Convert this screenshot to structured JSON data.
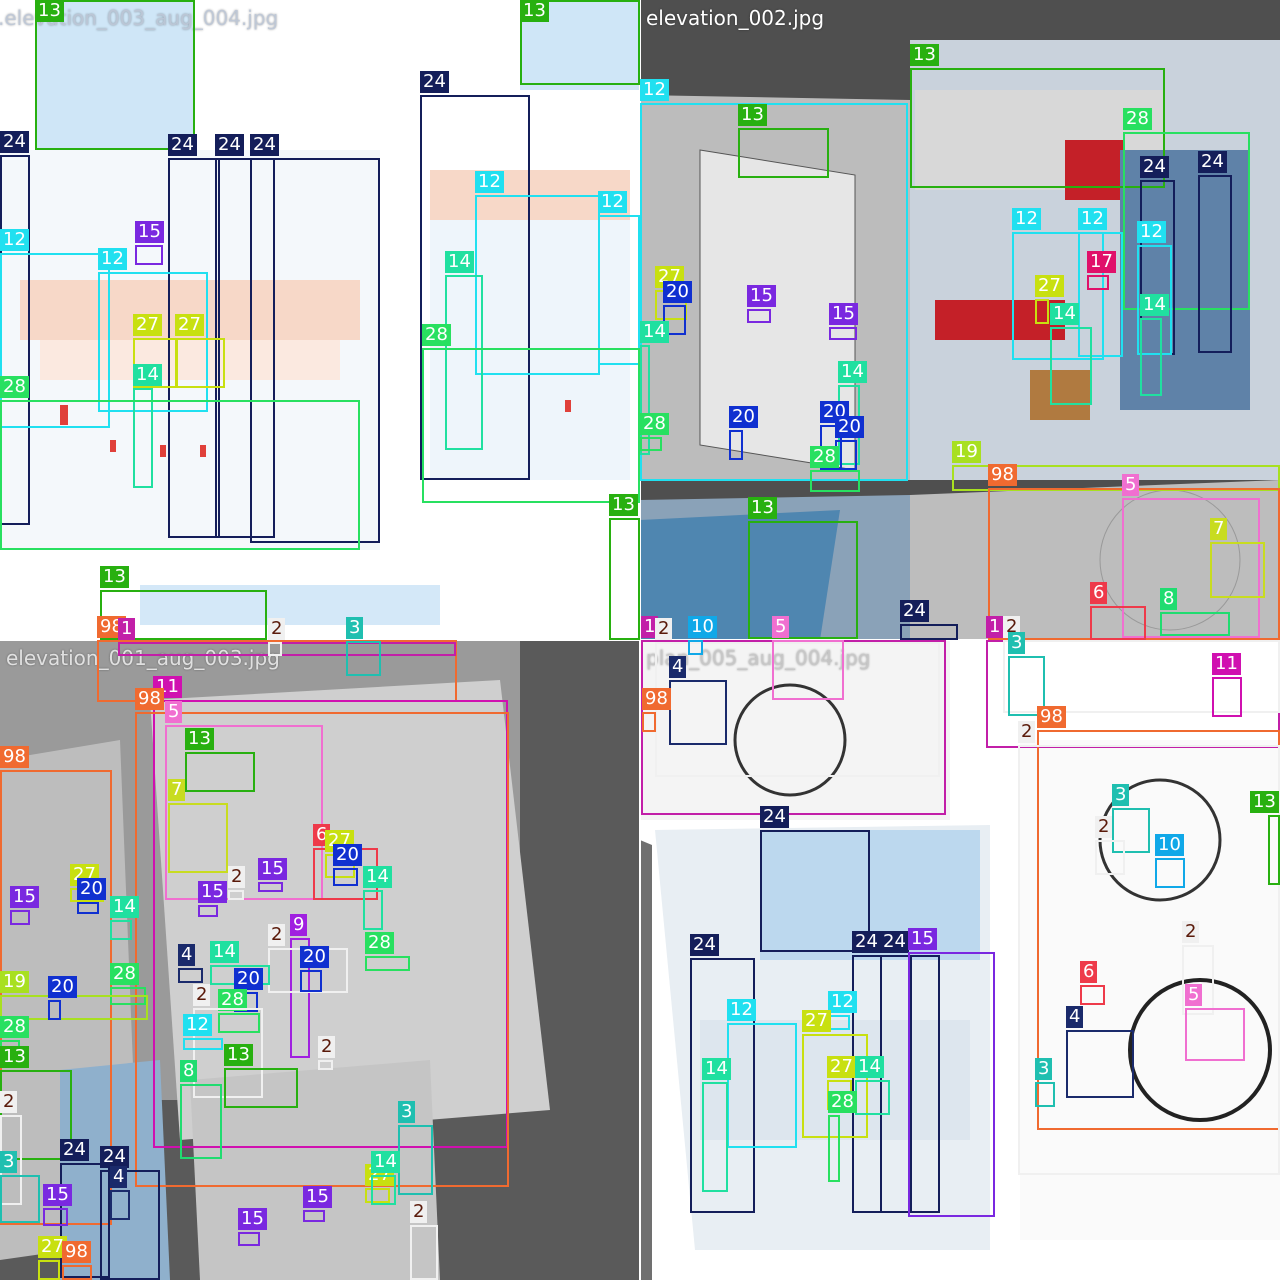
{
  "mosaic": {
    "tiles": [
      {
        "id": "tl",
        "filename": ".elevation_003_aug_004.jpg"
      },
      {
        "id": "tr",
        "filename": "elevation_002.jpg"
      },
      {
        "id": "bl",
        "filename": "elevation_001_aug_003.jpg"
      },
      {
        "id": "br",
        "filename": "plan_005_aug_004.jpg"
      }
    ]
  },
  "class_colors": {
    "1": "#c21fa8",
    "2": "#f0f0f0",
    "3": "#1fbfb0",
    "4": "#1a2a6b",
    "5": "#f06fd0",
    "6": "#ee3a4a",
    "7": "#c8dc20",
    "8": "#20dc70",
    "9": "#a020e0",
    "10": "#10a8e8",
    "11": "#d010b0",
    "12": "#20e0f0",
    "13": "#28b010",
    "14": "#20e0a0",
    "15": "#7a28e0",
    "17": "#e0106a",
    "19": "#a8e020",
    "20": "#1030d0",
    "24": "#141e5a",
    "27": "#c8e010",
    "28": "#28e060",
    "98": "#f06a30"
  },
  "detections": [
    {
      "c": "13",
      "l": "13"
    },
    {
      "c": "13",
      "l": "13"
    },
    {
      "c": "24",
      "l": "24"
    },
    {
      "c": "24",
      "l": "24"
    },
    {
      "c": "24",
      "l": "24"
    },
    {
      "c": "24",
      "l": "24"
    },
    {
      "c": "24",
      "l": "24"
    },
    {
      "c": "12",
      "l": "12"
    },
    {
      "c": "12",
      "l": "12"
    },
    {
      "c": "12",
      "l": "12"
    },
    {
      "c": "12",
      "l": "12"
    },
    {
      "c": "15",
      "l": "15"
    },
    {
      "c": "27",
      "l": "27"
    },
    {
      "c": "27",
      "l": "27"
    },
    {
      "c": "14",
      "l": "14"
    },
    {
      "c": "14",
      "l": "14"
    },
    {
      "c": "28",
      "l": "28"
    },
    {
      "c": "28",
      "l": "28"
    },
    {
      "c": "13",
      "l": "13"
    },
    {
      "c": "13",
      "l": "13"
    },
    {
      "c": "13",
      "l": "13"
    },
    {
      "c": "12",
      "l": "12"
    },
    {
      "c": "13",
      "l": "13"
    },
    {
      "c": "28",
      "l": "28"
    },
    {
      "c": "24",
      "l": "24"
    },
    {
      "c": "24",
      "l": "24"
    },
    {
      "c": "12",
      "l": "12"
    },
    {
      "c": "12",
      "l": "12"
    },
    {
      "c": "17",
      "l": "17"
    },
    {
      "c": "12",
      "l": "12"
    },
    {
      "c": "27",
      "l": "27"
    },
    {
      "c": "14",
      "l": "14"
    },
    {
      "c": "14",
      "l": "14"
    },
    {
      "c": "27",
      "l": "27"
    },
    {
      "c": "20",
      "l": "20"
    },
    {
      "c": "15",
      "l": "15"
    },
    {
      "c": "15",
      "l": "15"
    },
    {
      "c": "14",
      "l": "14"
    },
    {
      "c": "14",
      "l": "14"
    },
    {
      "c": "20",
      "l": "20"
    },
    {
      "c": "20",
      "l": "20"
    },
    {
      "c": "20",
      "l": "20"
    },
    {
      "c": "28",
      "l": "28"
    },
    {
      "c": "28",
      "l": "28"
    },
    {
      "c": "19",
      "l": "19"
    },
    {
      "c": "98",
      "l": "98"
    },
    {
      "c": "5",
      "l": "5"
    },
    {
      "c": "7",
      "l": "7"
    },
    {
      "c": "6",
      "l": "6"
    },
    {
      "c": "13",
      "l": "13"
    },
    {
      "c": "24",
      "l": "24"
    },
    {
      "c": "98",
      "l": "98"
    },
    {
      "c": "1",
      "l": "1"
    },
    {
      "c": "2",
      "l": "2"
    },
    {
      "c": "3",
      "l": "3"
    },
    {
      "c": "11",
      "l": "11"
    },
    {
      "c": "98",
      "l": "98"
    },
    {
      "c": "5",
      "l": "5"
    },
    {
      "c": "13",
      "l": "13"
    },
    {
      "c": "7",
      "l": "7"
    },
    {
      "c": "6",
      "l": "6"
    },
    {
      "c": "27",
      "l": "27"
    },
    {
      "c": "20",
      "l": "20"
    },
    {
      "c": "15",
      "l": "15"
    },
    {
      "c": "15",
      "l": "15"
    },
    {
      "c": "2",
      "l": "2"
    },
    {
      "c": "14",
      "l": "14"
    },
    {
      "c": "9",
      "l": "9"
    },
    {
      "c": "2",
      "l": "2"
    },
    {
      "c": "14",
      "l": "14"
    },
    {
      "c": "20",
      "l": "20"
    },
    {
      "c": "20",
      "l": "20"
    },
    {
      "c": "4",
      "l": "4"
    },
    {
      "c": "28",
      "l": "28"
    },
    {
      "c": "28",
      "l": "28"
    },
    {
      "c": "2",
      "l": "2"
    },
    {
      "c": "12",
      "l": "12"
    },
    {
      "c": "13",
      "l": "13"
    },
    {
      "c": "2",
      "l": "2"
    },
    {
      "c": "8",
      "l": "8"
    },
    {
      "c": "3",
      "l": "3"
    },
    {
      "c": "98",
      "l": "98"
    },
    {
      "c": "15",
      "l": "15"
    },
    {
      "c": "27",
      "l": "27"
    },
    {
      "c": "20",
      "l": "20"
    },
    {
      "c": "14",
      "l": "14"
    },
    {
      "c": "28",
      "l": "28"
    },
    {
      "c": "19",
      "l": "19"
    },
    {
      "c": "20",
      "l": "20"
    },
    {
      "c": "28",
      "l": "28"
    },
    {
      "c": "13",
      "l": "13"
    },
    {
      "c": "2",
      "l": "2"
    },
    {
      "c": "3",
      "l": "3"
    },
    {
      "c": "24",
      "l": "24"
    },
    {
      "c": "24",
      "l": "24"
    },
    {
      "c": "4",
      "l": "4"
    },
    {
      "c": "15",
      "l": "15"
    },
    {
      "c": "15",
      "l": "15"
    },
    {
      "c": "15",
      "l": "15"
    },
    {
      "c": "27",
      "l": "27"
    },
    {
      "c": "14",
      "l": "14"
    },
    {
      "c": "2",
      "l": "2"
    },
    {
      "c": "27",
      "l": "27"
    },
    {
      "c": "98",
      "l": "98"
    },
    {
      "c": "1",
      "l": "1"
    },
    {
      "c": "2",
      "l": "2"
    },
    {
      "c": "10",
      "l": "10"
    },
    {
      "c": "5",
      "l": "5"
    },
    {
      "c": "4",
      "l": "4"
    },
    {
      "c": "98",
      "l": "98"
    },
    {
      "c": "1",
      "l": "1"
    },
    {
      "c": "2",
      "l": "2"
    },
    {
      "c": "8",
      "l": "8"
    },
    {
      "c": "3",
      "l": "3"
    },
    {
      "c": "11",
      "l": "11"
    },
    {
      "c": "98",
      "l": "98"
    },
    {
      "c": "2",
      "l": "2"
    },
    {
      "c": "3",
      "l": "3"
    },
    {
      "c": "2",
      "l": "2"
    },
    {
      "c": "10",
      "l": "10"
    },
    {
      "c": "2",
      "l": "2"
    },
    {
      "c": "6",
      "l": "6"
    },
    {
      "c": "5",
      "l": "5"
    },
    {
      "c": "4",
      "l": "4"
    },
    {
      "c": "3",
      "l": "3"
    },
    {
      "c": "13",
      "l": "13"
    },
    {
      "c": "24",
      "l": "24"
    },
    {
      "c": "24",
      "l": "24"
    },
    {
      "c": "24",
      "l": "24"
    },
    {
      "c": "24",
      "l": "24"
    },
    {
      "c": "15",
      "l": "15"
    },
    {
      "c": "12",
      "l": "12"
    },
    {
      "c": "12",
      "l": "12"
    },
    {
      "c": "27",
      "l": "27"
    },
    {
      "c": "27",
      "l": "27"
    },
    {
      "c": "14",
      "l": "14"
    },
    {
      "c": "14",
      "l": "14"
    },
    {
      "c": "28",
      "l": "28"
    }
  ]
}
